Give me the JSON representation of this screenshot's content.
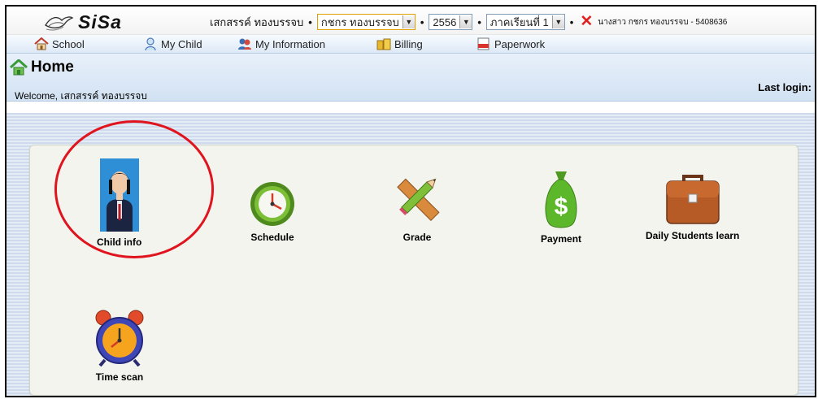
{
  "brand": {
    "name": "SiSa"
  },
  "userbar": {
    "parent_name": "เสกสรรค์ ทองบรรจบ",
    "child_select": "กชกร ทองบรรจบ",
    "year_select": "2556",
    "term_select": "ภาคเรียนที่ 1",
    "user_info": "นางสาว กชกร ทองบรรจบ - 5408636"
  },
  "nav": {
    "items": [
      {
        "label": "School",
        "icon": "school-icon"
      },
      {
        "label": "My Child",
        "icon": "child-icon"
      },
      {
        "label": "My Information",
        "icon": "information-icon"
      },
      {
        "label": "Billing",
        "icon": "billing-icon"
      },
      {
        "label": "Paperwork",
        "icon": "paperwork-icon"
      }
    ]
  },
  "header": {
    "title": "Home",
    "welcome": "Welcome, เสกสรรค์ ทองบรรจบ",
    "last_login": "Last login:"
  },
  "tiles": [
    {
      "label": "Child info",
      "icon": "student-photo"
    },
    {
      "label": "Schedule",
      "icon": "clock-icon"
    },
    {
      "label": "Grade",
      "icon": "pencil-ruler-icon"
    },
    {
      "label": "Payment",
      "icon": "money-bag-icon"
    },
    {
      "label": "Daily Students learn",
      "icon": "briefcase-icon"
    },
    {
      "label": "Time scan",
      "icon": "alarm-clock-icon"
    }
  ],
  "colors": {
    "highlight_circle": "#e0141e",
    "logout": "#e21f1f",
    "nav_bg": "#dde9f6"
  }
}
